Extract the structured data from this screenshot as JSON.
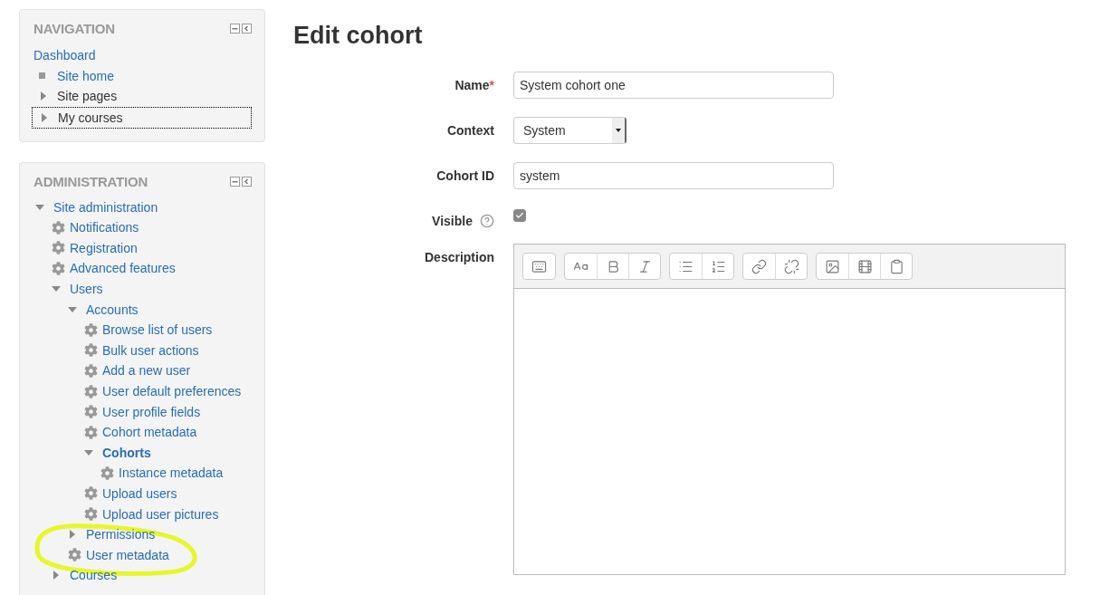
{
  "navigation": {
    "title": "NAVIGATION",
    "items": [
      {
        "label": "Dashboard",
        "kind": "plain",
        "link": true,
        "focused": false
      },
      {
        "label": "Site home",
        "kind": "bullet",
        "link": true,
        "focused": false
      },
      {
        "label": "Site pages",
        "kind": "branch",
        "link": false,
        "expanded": false,
        "focused": false
      },
      {
        "label": "My courses",
        "kind": "branch",
        "link": false,
        "expanded": false,
        "focused": true
      }
    ]
  },
  "administration": {
    "title": "ADMINISTRATION",
    "tree": [
      {
        "label": "Site administration",
        "kind": "branch",
        "expanded": true,
        "current": false,
        "children": [
          {
            "label": "Notifications",
            "kind": "gear",
            "current": false
          },
          {
            "label": "Registration",
            "kind": "gear",
            "current": false
          },
          {
            "label": "Advanced features",
            "kind": "gear",
            "current": false
          },
          {
            "label": "Users",
            "kind": "branch",
            "expanded": true,
            "current": false,
            "children": [
              {
                "label": "Accounts",
                "kind": "branch",
                "expanded": true,
                "current": false,
                "children": [
                  {
                    "label": "Browse list of users",
                    "kind": "gear",
                    "current": false
                  },
                  {
                    "label": "Bulk user actions",
                    "kind": "gear",
                    "current": false
                  },
                  {
                    "label": "Add a new user",
                    "kind": "gear",
                    "current": false
                  },
                  {
                    "label": "User default preferences",
                    "kind": "gear",
                    "current": false
                  },
                  {
                    "label": "User profile fields",
                    "kind": "gear",
                    "current": false
                  },
                  {
                    "label": "Cohort metadata",
                    "kind": "gear",
                    "current": false
                  },
                  {
                    "label": "Cohorts",
                    "kind": "branch",
                    "expanded": true,
                    "current": true,
                    "children": [
                      {
                        "label": "Instance metadata",
                        "kind": "gear",
                        "current": false
                      }
                    ]
                  },
                  {
                    "label": "Upload users",
                    "kind": "gear",
                    "current": false
                  },
                  {
                    "label": "Upload user pictures",
                    "kind": "gear",
                    "current": false
                  }
                ]
              },
              {
                "label": "Permissions",
                "kind": "branch",
                "expanded": false,
                "current": false
              },
              {
                "label": "User metadata",
                "kind": "gear",
                "current": false
              }
            ]
          },
          {
            "label": "Courses",
            "kind": "branch",
            "expanded": false,
            "current": false
          }
        ]
      }
    ]
  },
  "page_title": "Edit cohort",
  "form": {
    "fields": [
      {
        "label": "Name",
        "required_mark": "*",
        "kind": "text",
        "value": "System cohort one"
      },
      {
        "label": "Context",
        "kind": "select",
        "value": "System"
      },
      {
        "label": "Cohort ID",
        "kind": "text",
        "value": "system"
      },
      {
        "label": "Visible",
        "kind": "checkbox",
        "help": true,
        "checked": true
      },
      {
        "label": "Description",
        "kind": "editor"
      }
    ]
  }
}
